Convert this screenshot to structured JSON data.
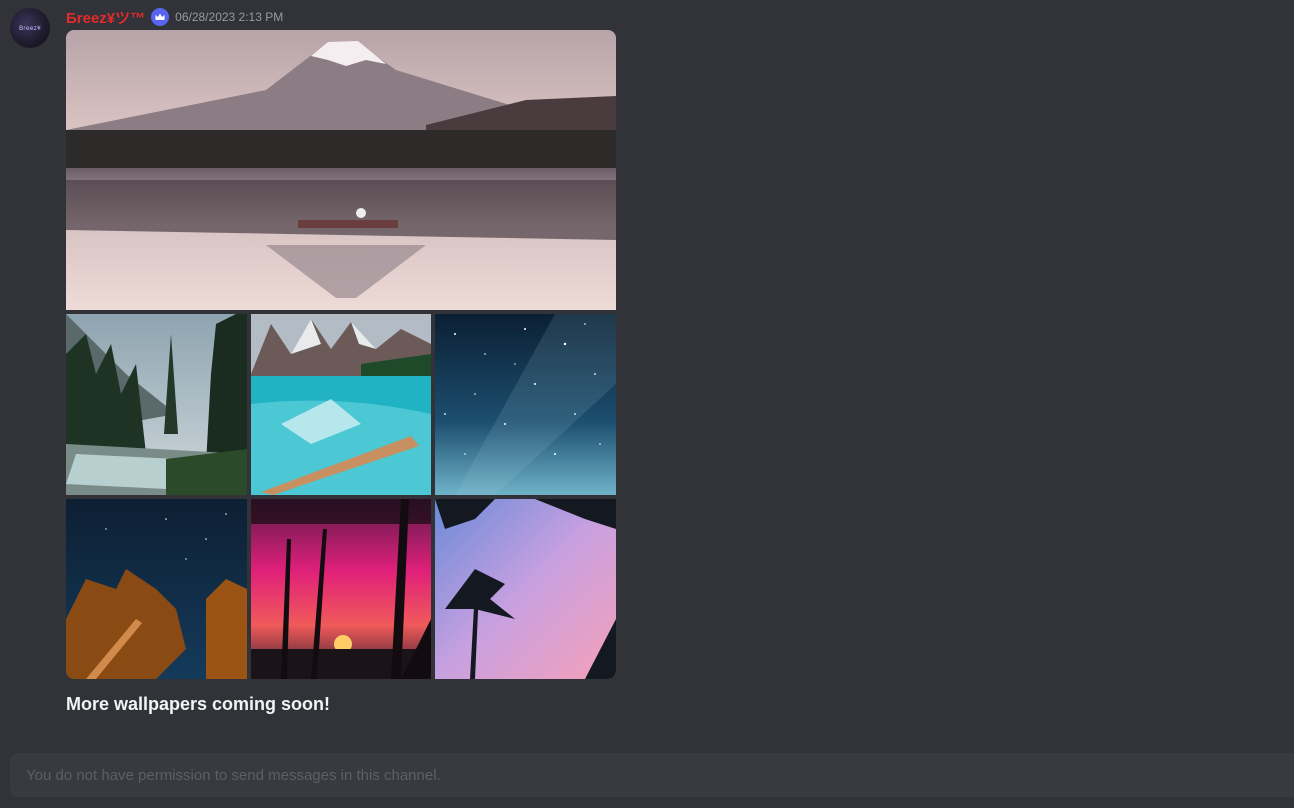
{
  "message": {
    "author": "Бreez¥ツ™",
    "author_color": "#e32b2b",
    "badge_icon": "crown-icon",
    "timestamp": "06/28/2023 2:13 PM",
    "avatar_text": "Breez¥",
    "text": "More wallpapers coming soon!",
    "attachments": [
      {
        "name": "mountain-lake-reflection-image",
        "subject": "Snow-capped mountain reflected in lake with rowboat"
      },
      {
        "name": "forest-river-image",
        "subject": "Forest river with pine trees"
      },
      {
        "name": "turquoise-lake-image",
        "subject": "Turquoise mountain lake with log"
      },
      {
        "name": "starry-sky-image",
        "subject": "Starry night sky"
      },
      {
        "name": "night-trees-image",
        "subject": "Trees under night sky"
      },
      {
        "name": "pink-sunset-palms-image",
        "subject": "Pink sunset with palm trees"
      },
      {
        "name": "pastel-palms-image",
        "subject": "Palm trees against pastel sky"
      }
    ]
  },
  "composer": {
    "disabled_text": "You do not have permission to send messages in this channel."
  },
  "colors": {
    "background": "#313338",
    "composer_bg": "#383a40",
    "badge": "#5865f2",
    "timestamp": "#949ba4",
    "message_text": "#f2f3f5"
  }
}
